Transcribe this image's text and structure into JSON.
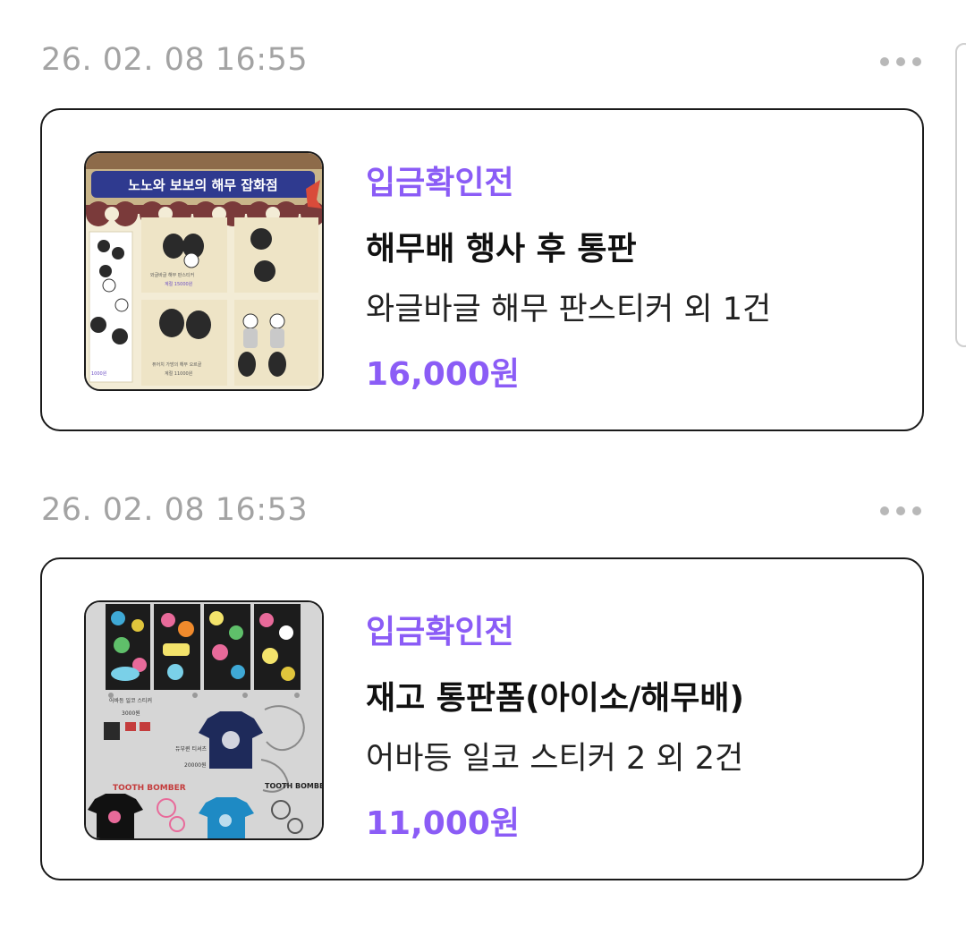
{
  "orders": [
    {
      "date": "26. 02. 08 16:55",
      "status": "입금확인전",
      "title": "해무배 행사 후 통판",
      "items": "와글바글 해무 판스티커 외 1건",
      "price": "16,000원",
      "thumbnail": {
        "banner": "노노와 보보의 해무 잡화점",
        "labels": [
          "와글바글 해무 판스티커",
          "계절 15000원",
          "퓨어치 가방의 해무 오르골",
          "계절 11000원",
          "1000원"
        ]
      },
      "colors": {
        "status": "#8b5cf6",
        "price": "#8b5cf6"
      }
    },
    {
      "date": "26. 02. 08 16:53",
      "status": "입금확인전",
      "title": "재고 통판폼(아이소/해무배)",
      "items": "어바등 일코 스티커 2 외 2건",
      "price": "11,000원",
      "thumbnail": {
        "labels": [
          "어바등 일코 스티커",
          "3000원",
          "듀부퀸 티셔츠",
          "20000원",
          "TOOTH BOMBER"
        ]
      },
      "colors": {
        "status": "#8b5cf6",
        "price": "#8b5cf6"
      }
    }
  ],
  "icons": {
    "more": "more-horizontal-icon"
  }
}
